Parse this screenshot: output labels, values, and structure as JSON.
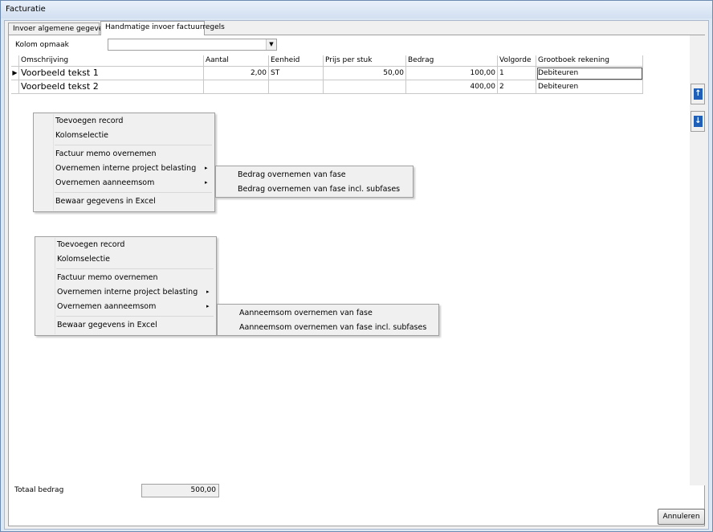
{
  "window": {
    "title": "Facturatie"
  },
  "tabs": [
    {
      "label": "Invoer algemene gegevens"
    },
    {
      "label": "Handmatige invoer factuurregels"
    }
  ],
  "kolom_opmaak": {
    "label": "Kolom opmaak",
    "value": ""
  },
  "grid": {
    "columns": [
      "Omschrijving",
      "Aantal",
      "Eenheid",
      "Prijs per stuk",
      "Bedrag",
      "Volgorde",
      "Grootboek rekening"
    ],
    "rows": [
      [
        "Voorbeeld tekst 1",
        "2,00",
        "ST",
        "50,00",
        "100,00",
        "1",
        "Debiteuren"
      ],
      [
        "Voorbeeld tekst 2",
        "",
        "",
        "",
        "400,00",
        "2",
        "Debiteuren"
      ]
    ]
  },
  "menu1": {
    "items": [
      "Toevoegen record",
      "Kolomselectie",
      "Factuur memo overnemen",
      "Overnemen interne project belasting",
      "Overnemen aanneemsom",
      "Bewaar gegevens in Excel"
    ],
    "submenu": [
      "Bedrag overnemen van fase",
      "Bedrag overnemen van fase incl. subfases"
    ]
  },
  "menu2": {
    "items": [
      "Toevoegen record",
      "Kolomselectie",
      "Factuur memo overnemen",
      "Overnemen interne project belasting",
      "Overnemen aanneemsom",
      "Bewaar gegevens in Excel"
    ],
    "submenu": [
      "Aanneemsom overnemen van fase",
      "Aanneemsom overnemen van fase incl. subfases"
    ]
  },
  "totaal": {
    "label": "Totaal bedrag",
    "value": "500,00"
  },
  "buttons": {
    "annuleren": "Annuleren"
  },
  "icons": {
    "submenu_arrow": "▸",
    "row_indicator": "▶",
    "combo_arrow": "▼",
    "move_up": "↑",
    "move_down": "↓"
  },
  "colors": {
    "accent": "#1f5fb8",
    "window_border": "#6d8bb0"
  }
}
